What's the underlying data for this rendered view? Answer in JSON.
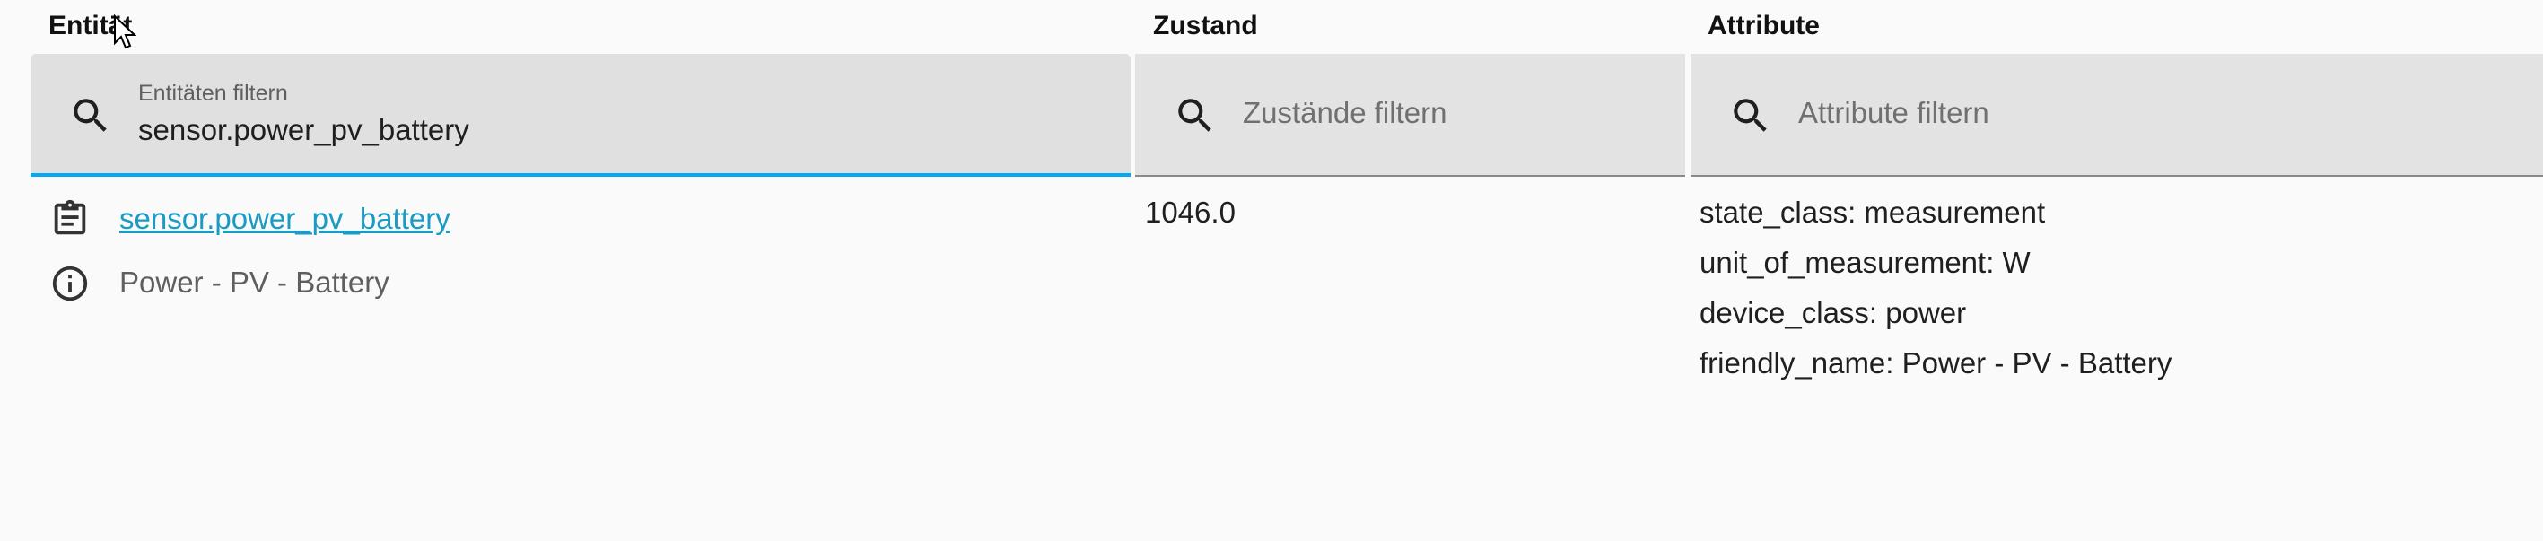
{
  "columns": {
    "entity": "Entität",
    "state": "Zustand",
    "attributes": "Attribute"
  },
  "filters": {
    "entity": {
      "label": "Entitäten filtern",
      "value": "sensor.power_pv_battery",
      "icon": "search-icon"
    },
    "state": {
      "placeholder": "Zustände filtern",
      "icon": "search-icon"
    },
    "attributes": {
      "placeholder": "Attribute filtern",
      "icon": "search-icon"
    }
  },
  "rows": [
    {
      "entity_id": "sensor.power_pv_battery",
      "friendly_name": "Power - PV - Battery",
      "state": "1046.0",
      "attributes": [
        "state_class: measurement",
        "unit_of_measurement: W",
        "device_class: power",
        "friendly_name: Power - PV - Battery"
      ],
      "icons": [
        "clipboard-icon",
        "info-icon"
      ]
    }
  ],
  "colors": {
    "accent": "#03a9f4",
    "link": "#1a9bc4",
    "filter_bg": "#e3e3e3",
    "page_bg": "#fafafa"
  }
}
